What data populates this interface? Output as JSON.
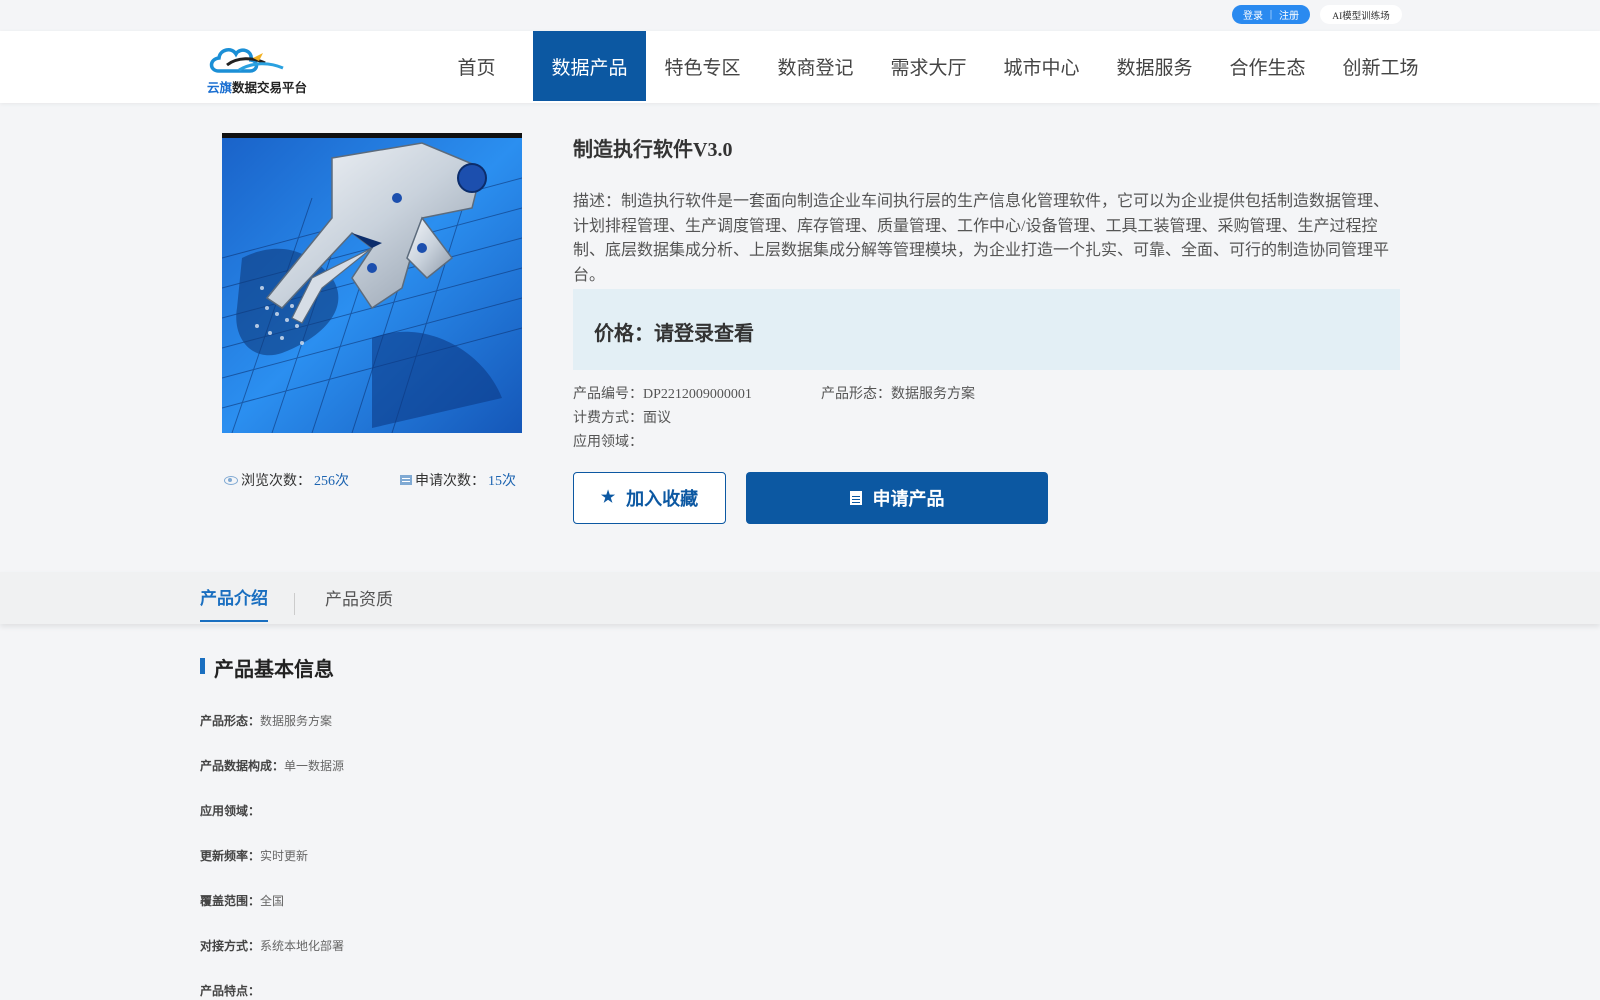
{
  "topbar": {
    "login": "登录",
    "separator": "|",
    "register": "注册",
    "ai_link": "AI模型训练场"
  },
  "brand": {
    "logo_part1": "云旗",
    "logo_part2": "数据交易平台",
    "color_primary": "#0c58a2",
    "color_accent": "#2a8af0"
  },
  "nav": {
    "items": [
      "首页",
      "数据产品",
      "特色专区",
      "数商登记",
      "需求大厅",
      "城市中心",
      "数据服务",
      "合作生态",
      "创新工场"
    ],
    "active_index": 1
  },
  "product": {
    "title": "制造执行软件V3.0",
    "description": "描述：制造执行软件是一套面向制造企业车间执行层的生产信息化管理软件，它可以为企业提供包括制造数据管理、计划排程管理、生产调度管理、库存管理、质量管理、工作中心/设备管理、工具工装管理、采购管理、生产过程控制、底层数据集成分析、上层数据集成分解等管理模块，为企业打造一个扎实、可靠、全面、可行的制造协同管理平台。",
    "price": "价格：请登录查看",
    "code": "产品编号：DP2212009000001",
    "form": "产品形态：数据服务方案",
    "billing": "计费方式：面议",
    "domain": "应用领域：",
    "views_label": "浏览次数：",
    "views_value": "256次",
    "apply_label": "申请次数：",
    "apply_value": "15次",
    "favorite_btn": "加入收藏",
    "apply_btn": "申请产品"
  },
  "tabs": [
    "产品介绍",
    "产品资质"
  ],
  "basic_info": {
    "heading": "产品基本信息",
    "rows": [
      {
        "k": "产品形态：",
        "v": "数据服务方案"
      },
      {
        "k": "产品数据构成：",
        "v": "单一数据源"
      },
      {
        "k": "应用领域：",
        "v": ""
      },
      {
        "k": "更新频率：",
        "v": "实时更新"
      },
      {
        "k": "覆盖范围：",
        "v": "全国"
      },
      {
        "k": "对接方式：",
        "v": "系统本地化部署"
      },
      {
        "k": "产品特点：",
        "v": ""
      }
    ]
  }
}
